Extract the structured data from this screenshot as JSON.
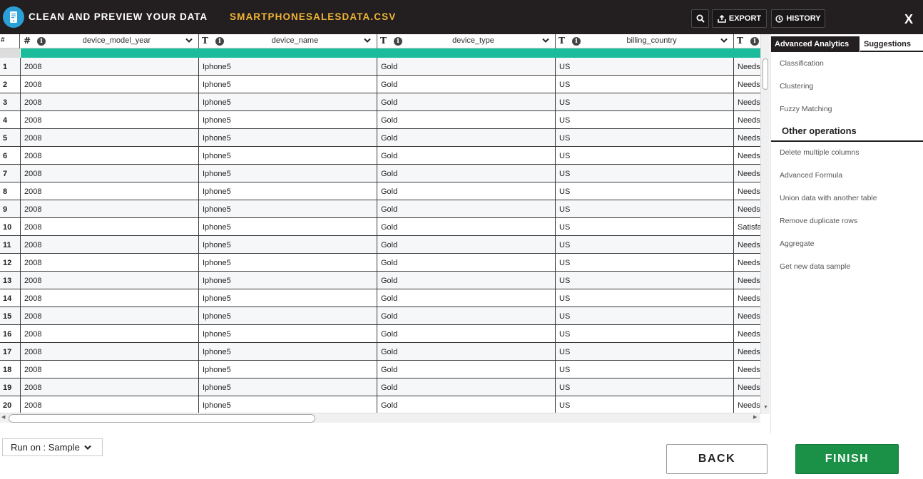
{
  "header": {
    "title": "CLEAN AND PREVIEW YOUR DATA",
    "file_name": "SMARTPHONESALESDATA.CSV",
    "export_label": "EXPORT",
    "history_label": "HISTORY",
    "close_label": "X"
  },
  "grid": {
    "rownum_header": "#",
    "columns": [
      {
        "type": "#",
        "name": "device_model_year"
      },
      {
        "type": "T",
        "name": "device_name"
      },
      {
        "type": "T",
        "name": "device_type"
      },
      {
        "type": "T",
        "name": "billing_country"
      },
      {
        "type": "T",
        "name": ""
      }
    ],
    "info_glyph": "i",
    "quality_color": "#1abc9c",
    "rows": [
      {
        "n": "1",
        "cells": [
          "2008",
          "Iphone5",
          "Gold",
          "US",
          "Needs"
        ]
      },
      {
        "n": "2",
        "cells": [
          "2008",
          "Iphone5",
          "Gold",
          "US",
          "Needs"
        ]
      },
      {
        "n": "3",
        "cells": [
          "2008",
          "Iphone5",
          "Gold",
          "US",
          "Needs"
        ]
      },
      {
        "n": "4",
        "cells": [
          "2008",
          "Iphone5",
          "Gold",
          "US",
          "Needs"
        ]
      },
      {
        "n": "5",
        "cells": [
          "2008",
          "Iphone5",
          "Gold",
          "US",
          "Needs"
        ]
      },
      {
        "n": "6",
        "cells": [
          "2008",
          "Iphone5",
          "Gold",
          "US",
          "Needs"
        ]
      },
      {
        "n": "7",
        "cells": [
          "2008",
          "Iphone5",
          "Gold",
          "US",
          "Needs"
        ]
      },
      {
        "n": "8",
        "cells": [
          "2008",
          "Iphone5",
          "Gold",
          "US",
          "Needs"
        ]
      },
      {
        "n": "9",
        "cells": [
          "2008",
          "Iphone5",
          "Gold",
          "US",
          "Needs"
        ]
      },
      {
        "n": "10",
        "cells": [
          "2008",
          "Iphone5",
          "Gold",
          "US",
          "Satisfa"
        ]
      },
      {
        "n": "11",
        "cells": [
          "2008",
          "Iphone5",
          "Gold",
          "US",
          "Needs"
        ]
      },
      {
        "n": "12",
        "cells": [
          "2008",
          "Iphone5",
          "Gold",
          "US",
          "Needs"
        ]
      },
      {
        "n": "13",
        "cells": [
          "2008",
          "Iphone5",
          "Gold",
          "US",
          "Needs"
        ]
      },
      {
        "n": "14",
        "cells": [
          "2008",
          "Iphone5",
          "Gold",
          "US",
          "Needs"
        ]
      },
      {
        "n": "15",
        "cells": [
          "2008",
          "Iphone5",
          "Gold",
          "US",
          "Needs"
        ]
      },
      {
        "n": "16",
        "cells": [
          "2008",
          "Iphone5",
          "Gold",
          "US",
          "Needs"
        ]
      },
      {
        "n": "17",
        "cells": [
          "2008",
          "Iphone5",
          "Gold",
          "US",
          "Needs"
        ]
      },
      {
        "n": "18",
        "cells": [
          "2008",
          "Iphone5",
          "Gold",
          "US",
          "Needs"
        ]
      },
      {
        "n": "19",
        "cells": [
          "2008",
          "Iphone5",
          "Gold",
          "US",
          "Needs"
        ]
      },
      {
        "n": "20",
        "cells": [
          "2008",
          "Iphone5",
          "Gold",
          "US",
          "Needs"
        ]
      }
    ]
  },
  "sidebar": {
    "tabs": [
      {
        "label": "Advanced Analytics",
        "active": true
      },
      {
        "label": "Suggestions",
        "active": false
      }
    ],
    "analytics_items": [
      "Classification",
      "Clustering",
      "Fuzzy Matching"
    ],
    "other_heading": "Other operations",
    "other_items": [
      "Delete multiple columns",
      "Advanced Formula",
      "Union data with another table",
      "Remove duplicate rows",
      "Aggregate",
      "Get new data sample"
    ]
  },
  "footer": {
    "run_on_label": "Run on : Sample",
    "back_label": "BACK",
    "finish_label": "FINISH"
  },
  "icons": {
    "app": "phone-doc-icon",
    "search": "search-icon",
    "export": "export-icon",
    "history": "clock-icon",
    "column_menu": "chevron-down-icon",
    "run_on_caret": "chevron-down-icon"
  },
  "colors": {
    "topbar": "#231f20",
    "file_name": "#f0b434",
    "finish": "#1a9146",
    "app_icon": "#2a9fd8"
  }
}
